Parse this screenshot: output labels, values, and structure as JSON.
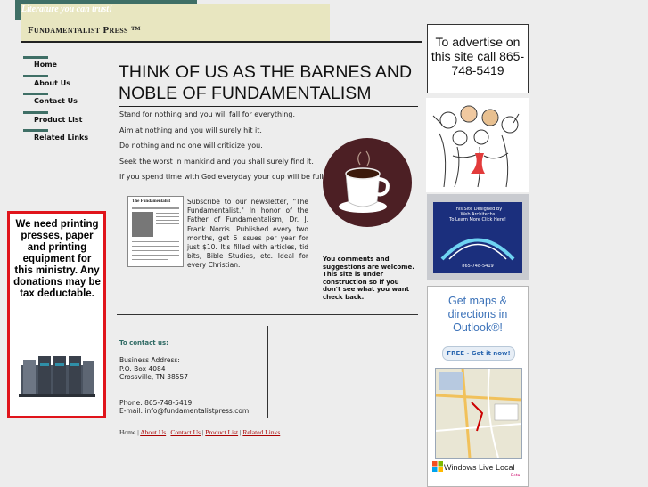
{
  "header": {
    "tagline": "Literature you can trust!",
    "brand": "Fundamentalist Press ™"
  },
  "nav": {
    "items": [
      {
        "label": "Home"
      },
      {
        "label": "About Us"
      },
      {
        "label": "Contact Us"
      },
      {
        "label": "Product List"
      },
      {
        "label": "Related Links"
      }
    ]
  },
  "main": {
    "headline": "THINK OF US AS THE BARNES AND NOBLE OF FUNDAMENTALISM",
    "sayings": [
      "Stand for nothing and you will fall for everything.",
      "Aim at nothing and you will surely hit it.",
      "Do nothing and no one will criticize you.",
      "Seek the worst in mankind and you shall surely find it.",
      "If you spend time with God everyday your cup will be full."
    ],
    "newsletter_thumb_title": "The Fundamentalist",
    "newsletter": "Subscribe to our newsletter, \"The Fundamentalist.\" In honor of the Father of Fundamentalism, Dr. J. Frank Norris. Published every two months, get 6 issues per year for just $10.  It's filled with articles, tid bits, Bible Studies, etc.  Ideal for every Christian.",
    "comments_line1": "You comments and suggestions are welcome.",
    "comments_line2": "This site is under construction so if you don't see what you want check back."
  },
  "contact": {
    "heading": "To contact us:",
    "address_label": "Business Address:",
    "address_line1": "P.O. Box 4084",
    "address_line2": "Crossville, TN 38557",
    "phone": "Phone: 865-748-5419",
    "email": "E-mail: info@fundamentalistpress.com"
  },
  "footer": {
    "links": [
      "Home",
      "About Us",
      "Contact Us",
      "Product List",
      "Related Links"
    ],
    "separator": " | "
  },
  "donate": {
    "text": "We need printing presses, paper and printing equipment for this ministry. Any donations may be tax deductable."
  },
  "sidebar_right": {
    "advert": "To advertise on this site call 865-748-5419",
    "webarch_line1": "This Site Designed By",
    "webarch_line2": "Web Architechs",
    "webarch_line3": "To Learn More Click Here!",
    "webarch_phone": "865-748-5419",
    "maps_title": "Get maps & directions in Outlook®!",
    "maps_button": "FREE - Get it now!",
    "maps_footer": "Windows Live Local",
    "maps_beta": "Beta"
  },
  "colors": {
    "accent": "#3f6f66",
    "brand_bg": "#e8e6c0",
    "donate_border": "#e0141b",
    "cup_bg": "#4c1f24",
    "link": "#aa0000"
  }
}
